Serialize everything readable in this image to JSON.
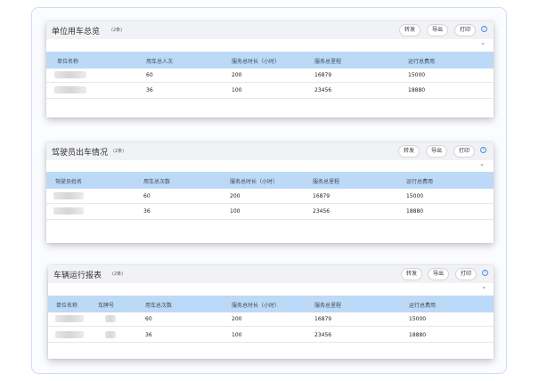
{
  "buttons": {
    "forward": "转发",
    "export": "导出",
    "print": "打印"
  },
  "card1": {
    "title": "单位用车总览",
    "count": "(2条)",
    "headers": [
      "单位名称",
      "用车总人次",
      "服务总时长（小时）",
      "服务总里程",
      "运行总费用"
    ],
    "rows": [
      {
        "trips": "60",
        "hours": "200",
        "mileage": "16879",
        "cost": "15000"
      },
      {
        "trips": "36",
        "hours": "100",
        "mileage": "23456",
        "cost": "18880"
      }
    ]
  },
  "card2": {
    "title": "驾驶员出车情况",
    "count": "(2条)",
    "headers": [
      "驾驶员姓名",
      "用车总次数",
      "服务总时长（小时）",
      "服务总里程",
      "运行总费用"
    ],
    "rows": [
      {
        "trips": "60",
        "hours": "200",
        "mileage": "16879",
        "cost": "15000"
      },
      {
        "trips": "36",
        "hours": "100",
        "mileage": "23456",
        "cost": "18880"
      }
    ]
  },
  "card3": {
    "title": "车辆运行报表",
    "count": "(2条)",
    "headers": [
      "单位名称",
      "车牌号",
      "用车总次数",
      "服务总时长（小时）",
      "服务总里程",
      "运行总费用"
    ],
    "rows": [
      {
        "trips": "60",
        "hours": "200",
        "mileage": "16879",
        "cost": "15000"
      },
      {
        "trips": "36",
        "hours": "100",
        "mileage": "23456",
        "cost": "18880"
      }
    ]
  },
  "colors": {
    "header_bg": "#f1f2f5",
    "table_head": "#bcdaf7",
    "accent": "#4a8ef0",
    "frame_border": "#cfdcf3"
  },
  "icons": {
    "help": "help-circle-icon",
    "expand": "chevron-down-icon"
  }
}
